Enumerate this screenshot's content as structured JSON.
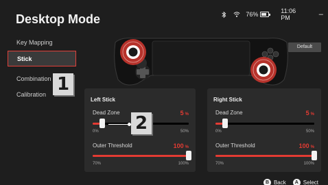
{
  "window": {
    "title": "Desktop Mode",
    "minimize_label": "–",
    "close_label": "✕"
  },
  "status_bar": {
    "bluetooth_icon": "bluetooth-icon",
    "wifi_icon": "wifi-icon",
    "battery_percent": "76%",
    "battery_level": 0.76,
    "time": "11:06 PM"
  },
  "sidebar": {
    "items": [
      {
        "label": "Key Mapping",
        "active": false
      },
      {
        "label": "Stick",
        "active": true
      },
      {
        "label": "Combination",
        "active": false
      },
      {
        "label": "Calibration",
        "active": false
      }
    ]
  },
  "annotations": {
    "badge1": "1",
    "badge2": "2"
  },
  "controller": {
    "default_label": "Default",
    "highlight_color": "#e33b33"
  },
  "left_stick": {
    "title": "Left Stick",
    "dead_zone": {
      "label": "Dead Zone",
      "value": "5",
      "unit": "%",
      "min_label": "0%",
      "max_label": "50%",
      "fraction": 0.1
    },
    "outer_threshold": {
      "label": "Outer Threshold",
      "value": "100",
      "unit": "%",
      "min_label": "70%",
      "max_label": "100%",
      "fraction": 1.0
    }
  },
  "right_stick": {
    "title": "Right Stick",
    "dead_zone": {
      "label": "Dead Zone",
      "value": "5",
      "unit": "%",
      "min_label": "0%",
      "max_label": "50%",
      "fraction": 0.1
    },
    "outer_threshold": {
      "label": "Outer Threshold",
      "value": "100",
      "unit": "%",
      "min_label": "70%",
      "max_label": "100%",
      "fraction": 1.0
    }
  },
  "footer": {
    "back_glyph": "B",
    "back_label": "Back",
    "select_glyph": "A",
    "select_label": "Select"
  },
  "colors": {
    "accent": "#e33b33",
    "background": "#1e1e1e",
    "panel": "#2b2b2b"
  }
}
